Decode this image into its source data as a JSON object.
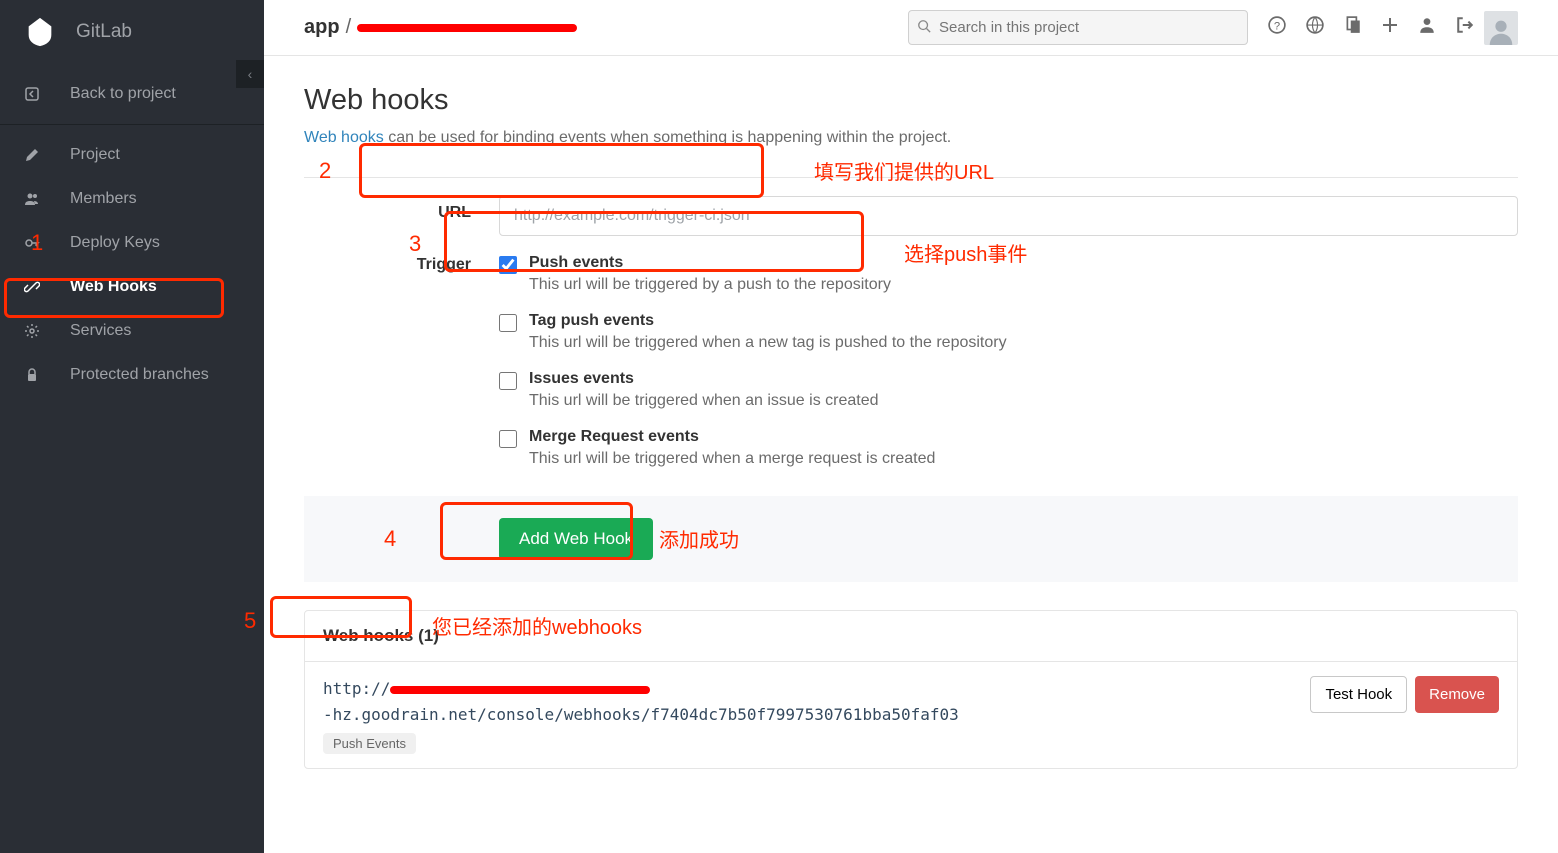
{
  "brand": "GitLab",
  "collapse_glyph": "‹",
  "nav": {
    "back": "Back to project",
    "items": [
      {
        "label": "Project"
      },
      {
        "label": "Members"
      },
      {
        "label": "Deploy Keys"
      },
      {
        "label": "Web Hooks"
      },
      {
        "label": "Services"
      },
      {
        "label": "Protected branches"
      }
    ]
  },
  "breadcrumb": {
    "app": "app",
    "sep": "/"
  },
  "search": {
    "placeholder": "Search in this project"
  },
  "page": {
    "title": "Web hooks",
    "desc_link": "Web hooks",
    "desc_rest": " can be used for binding events when something is happening within the project."
  },
  "form": {
    "url_label": "URL",
    "url_placeholder": "http://example.com/trigger-ci.json",
    "trigger_label": "Trigger",
    "triggers": [
      {
        "title": "Push events",
        "desc": "This url will be triggered by a push to the repository",
        "checked": true
      },
      {
        "title": "Tag push events",
        "desc": "This url will be triggered when a new tag is pushed to the repository",
        "checked": false
      },
      {
        "title": "Issues events",
        "desc": "This url will be triggered when an issue is created",
        "checked": false
      },
      {
        "title": "Merge Request events",
        "desc": "This url will be triggered when a merge request is created",
        "checked": false
      }
    ],
    "submit": "Add Web Hook"
  },
  "hooks": {
    "header": "Web hooks (1)",
    "url_prefix": "http://",
    "url_suffix": "-hz.goodrain.net/console/webhooks/f7404dc7b50f7997530761bba50faf03",
    "badge": "Push Events",
    "test": "Test Hook",
    "remove": "Remove"
  },
  "annotations": {
    "n1": "1",
    "n2": "2",
    "n3": "3",
    "n4": "4",
    "n5": "5",
    "t2": "填写我们提供的URL",
    "t3": "选择push事件",
    "t4": "添加成功",
    "t5": "您已经添加的webhooks"
  }
}
